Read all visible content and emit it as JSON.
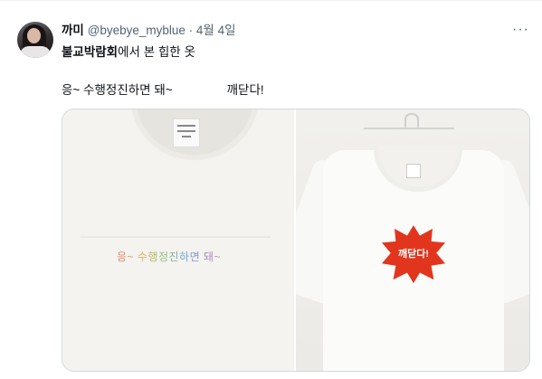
{
  "tweet": {
    "author_name": "까미",
    "handle": "@byebye_myblue",
    "separator": "·",
    "date": "4월 4일",
    "more_label": "···",
    "text_bold": "불교박람회",
    "text_rest": "에서 본 힙한 옷",
    "line2_first": "응~ 수행정진하면 돼~",
    "line2_second": "깨닫다!"
  },
  "media": {
    "left_print": "응~ 수행정진하면 돼~",
    "right_print": "깨닫다!"
  }
}
